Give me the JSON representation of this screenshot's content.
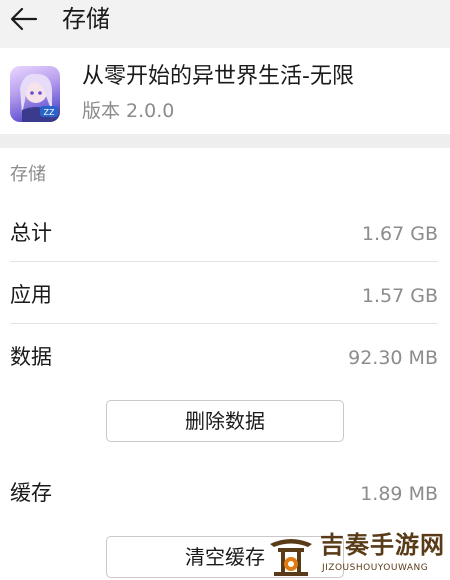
{
  "header": {
    "title": "存储",
    "back_icon": "arrow-left-icon"
  },
  "app": {
    "name": "从零开始的异世界生活-无限",
    "version": "版本 2.0.0",
    "icon": "anime-girl-app-icon"
  },
  "storage": {
    "section_label": "存储",
    "total": {
      "label": "总计",
      "value": "1.67 GB"
    },
    "app": {
      "label": "应用",
      "value": "1.57 GB"
    },
    "data": {
      "label": "数据",
      "value": "92.30 MB"
    },
    "clear_data_button": "删除数据",
    "cache": {
      "label": "缓存",
      "value": "1.89 MB"
    },
    "clear_cache_button": "清空缓存"
  },
  "watermark": {
    "title": "吉奏手游网",
    "subtitle": "JIZOUSHOUYOUWANG",
    "colors": {
      "brown": "#5a3b18",
      "orange": "#e07a12"
    }
  },
  "colors": {
    "header_bg": "#f2f2f2",
    "secondary_text": "#8c8c8c",
    "divider": "#e3e3e3"
  }
}
